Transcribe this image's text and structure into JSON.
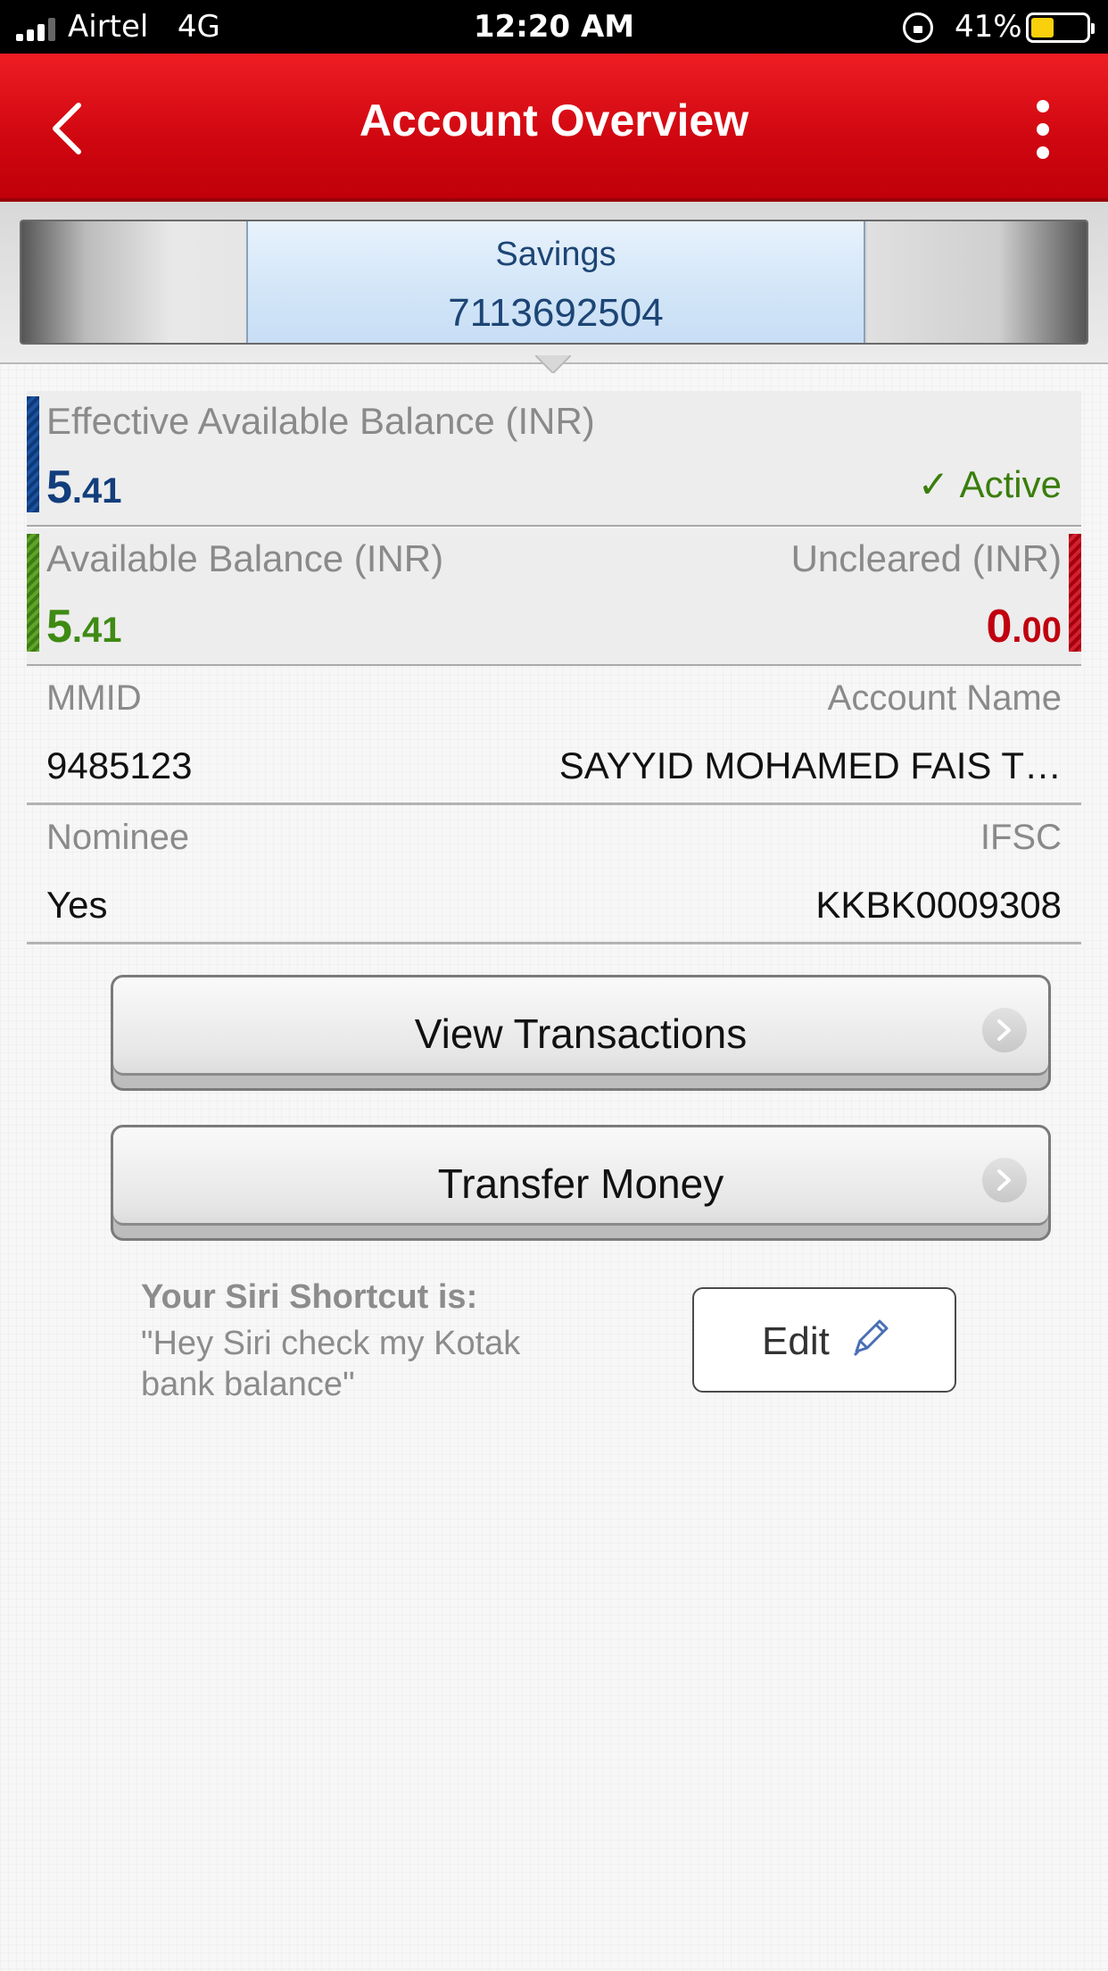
{
  "status_bar": {
    "carrier": "Airtel",
    "network": "4G",
    "time": "12:20 AM",
    "battery_percent": "41%",
    "battery_level": 0.41,
    "signal_bars": 3,
    "icons": [
      "signal-icon",
      "orientation-lock-icon",
      "battery-icon"
    ]
  },
  "header": {
    "title": "Account Overview",
    "back_icon": "chevron-left-icon",
    "menu_icon": "more-vertical-icon",
    "color": "#d90812"
  },
  "account": {
    "type": "Savings",
    "number": "7113692504"
  },
  "effective_balance": {
    "label": "Effective Available Balance (INR)",
    "amount_whole": "5",
    "amount_fraction": ".41",
    "status_check": "✓",
    "status": "Active",
    "color": "#123e7c",
    "status_color": "#3a7d0c"
  },
  "available_balance": {
    "label": "Available Balance (INR)",
    "amount_whole": "5",
    "amount_fraction": ".41",
    "color": "#3f8a14"
  },
  "uncleared": {
    "label": "Uncleared (INR)",
    "amount_whole": "0",
    "amount_fraction": ".00",
    "color": "#c0000f"
  },
  "details": {
    "mmid_label": "MMID",
    "mmid_value": "9485123",
    "account_name_label": "Account Name",
    "account_name_value": "SAYYID MOHAMED FAIS T…",
    "nominee_label": "Nominee",
    "nominee_value": "Yes",
    "ifsc_label": "IFSC",
    "ifsc_value": "KKBK0009308"
  },
  "actions": {
    "view_transactions": "View Transactions",
    "transfer_money": "Transfer Money",
    "chevron_icon": "chevron-right-icon"
  },
  "siri": {
    "title": "Your Siri Shortcut is:",
    "phrase": "\"Hey Siri check my Kotak bank balance\"",
    "edit_label": "Edit",
    "edit_icon": "pencil-icon"
  }
}
